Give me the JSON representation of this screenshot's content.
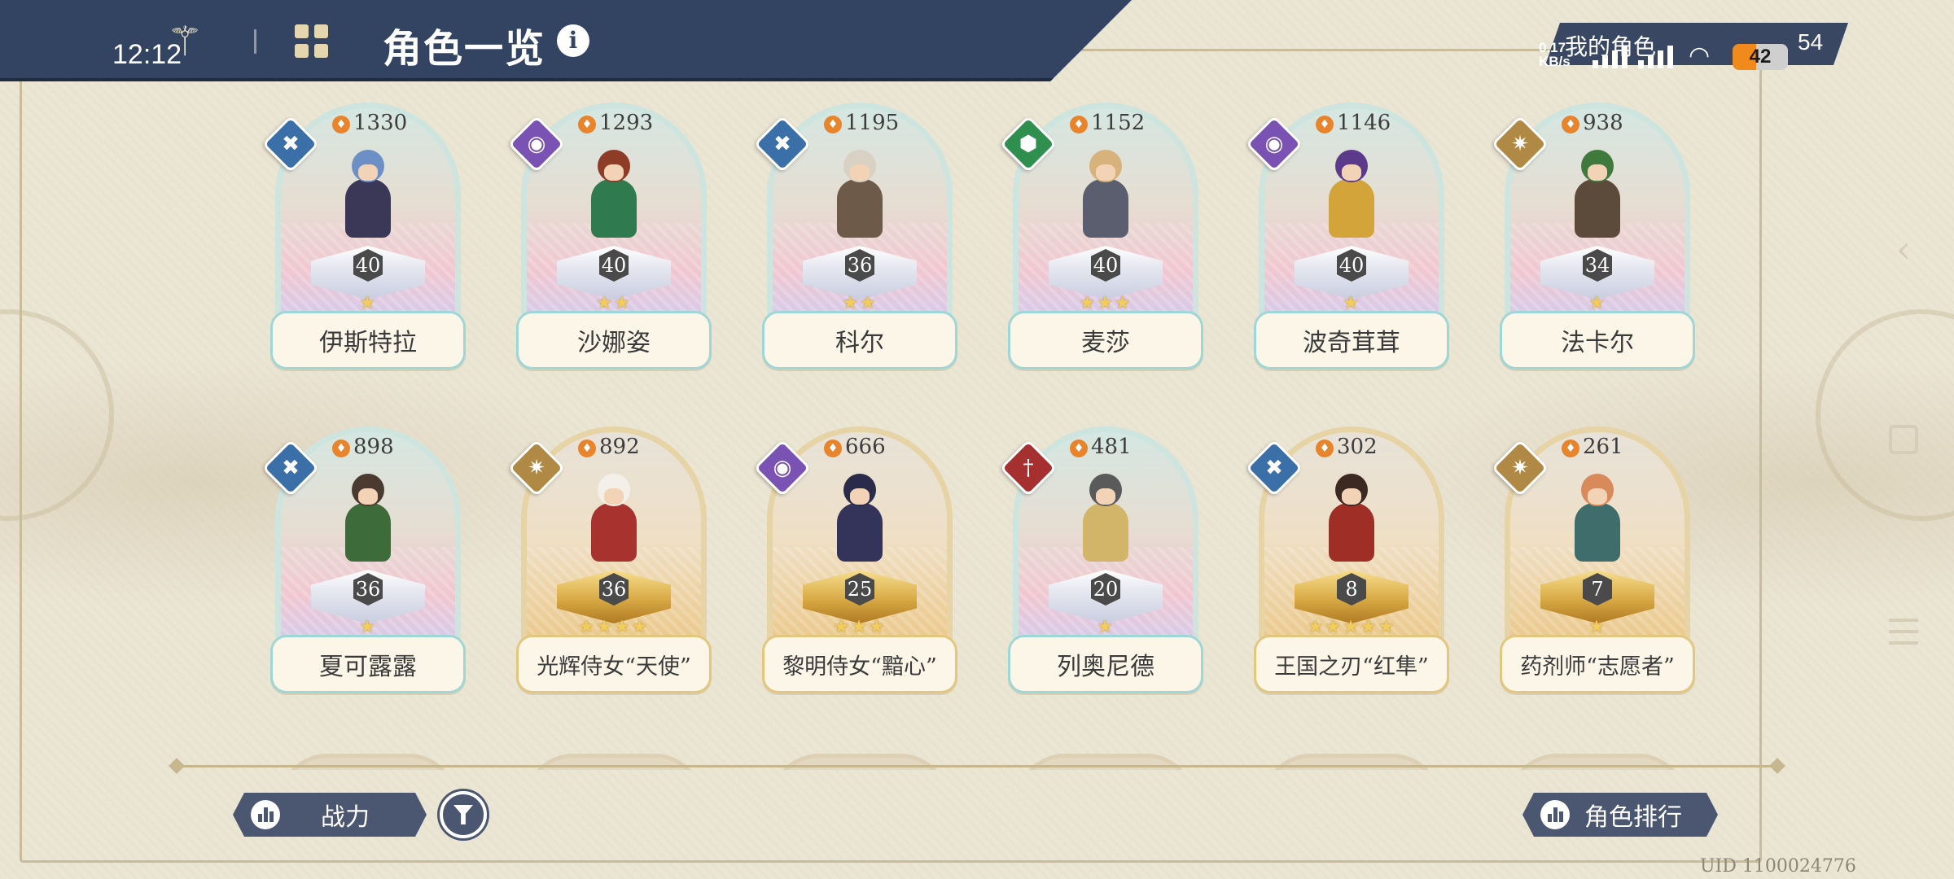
{
  "status_bar": {
    "time": "12:12",
    "net_speed": "0.17 KB/s",
    "battery": "42",
    "battery_level": 0.42
  },
  "header": {
    "title": "角色一览",
    "info_icon": "info-icon",
    "logo_icon": "trident-wing-icon",
    "menu_icon": "grid-icon"
  },
  "my_characters": {
    "label": "我的角色",
    "count": "54"
  },
  "colors": {
    "header_bg": "#324462",
    "storm": "#3b6fa8",
    "arcane": "#7a52b3",
    "guard": "#2f8f4f",
    "light": "#b08a45",
    "blade": "#a6302f",
    "nameplate_border_teal": "#9fd7d6",
    "nameplate_border_gold": "#e4c77e"
  },
  "characters": [
    {
      "name": "伊斯特拉",
      "power": "1330",
      "level": "40",
      "stars": "★",
      "class": "storm",
      "theme": "rainbow",
      "hair": "#6c8fc6",
      "cloth": "#3b3756"
    },
    {
      "name": "沙娜姿",
      "power": "1293",
      "level": "40",
      "stars": "★★",
      "class": "arcane",
      "theme": "rainbow",
      "hair": "#8e3c25",
      "cloth": "#2f7a4e"
    },
    {
      "name": "科尔",
      "power": "1195",
      "level": "36",
      "stars": "★★",
      "class": "storm",
      "theme": "rainbow",
      "hair": "#d9d2c4",
      "cloth": "#6e5a48"
    },
    {
      "name": "麦莎",
      "power": "1152",
      "level": "40",
      "stars": "★★★",
      "class": "guard",
      "theme": "rainbow",
      "hair": "#d7b27a",
      "cloth": "#5a5e6e"
    },
    {
      "name": "波奇茸茸",
      "power": "1146",
      "level": "40",
      "stars": "★",
      "class": "arcane",
      "theme": "rainbow",
      "hair": "#5b3a8c",
      "cloth": "#d3a43a"
    },
    {
      "name": "法卡尔",
      "power": "938",
      "level": "34",
      "stars": "★",
      "class": "light",
      "theme": "rainbow",
      "hair": "#3f7a3c",
      "cloth": "#5c4b3a"
    },
    {
      "name": "夏可露露",
      "power": "898",
      "level": "36",
      "stars": "★",
      "class": "storm",
      "theme": "rainbow",
      "hair": "#4a3a30",
      "cloth": "#3e6b3a"
    },
    {
      "name": "光辉侍女“天使”",
      "power": "892",
      "level": "36",
      "stars": "★★★★",
      "class": "light",
      "theme": "gold",
      "hair": "#f3f0ea",
      "cloth": "#a8322e"
    },
    {
      "name": "黎明侍女“黯心”",
      "power": "666",
      "level": "25",
      "stars": "★★★",
      "class": "arcane",
      "theme": "gold",
      "hair": "#2a2a4a",
      "cloth": "#34345a"
    },
    {
      "name": "列奥尼德",
      "power": "481",
      "level": "20",
      "stars": "★",
      "class": "blade",
      "theme": "rainbow",
      "hair": "#5a5a5a",
      "cloth": "#d2b568"
    },
    {
      "name": "王国之刃“红隼”",
      "power": "302",
      "level": "8",
      "stars": "★★★★★",
      "class": "storm",
      "theme": "gold",
      "hair": "#3c2a22",
      "cloth": "#9e2e26"
    },
    {
      "name": "药剂师“志愿者”",
      "power": "261",
      "level": "7",
      "stars": "★",
      "class": "light",
      "theme": "gold",
      "hair": "#d98a5a",
      "cloth": "#3e6d6b"
    }
  ],
  "bottom": {
    "sort_label": "战力",
    "sort_icon": "bar-chart-icon",
    "filter_icon": "filter-icon",
    "ranking_label": "角色排行",
    "ranking_icon": "bar-chart-icon",
    "uid": "UID 1100024776"
  },
  "class_icons": {
    "storm": "✖",
    "arcane": "◉",
    "guard": "⬢",
    "light": "✷",
    "blade": "†"
  }
}
